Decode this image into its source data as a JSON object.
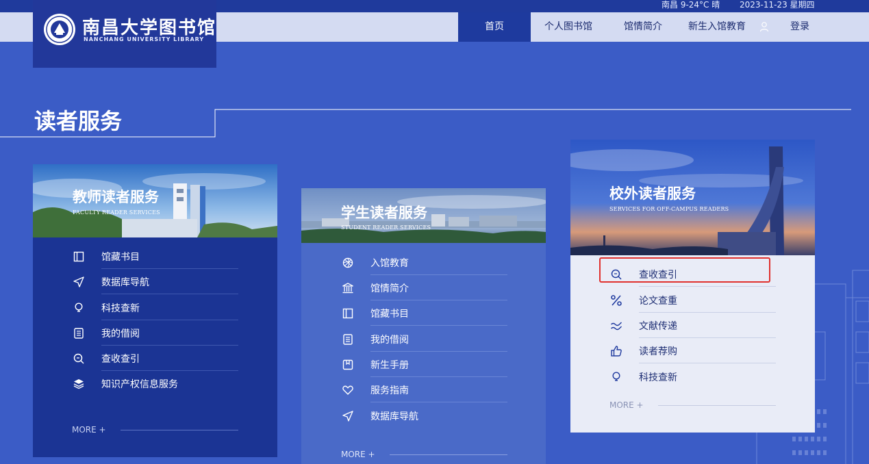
{
  "topbar": {
    "weather": "南昌 9-24°C 晴",
    "date": "2023-11-23 星期四"
  },
  "logo": {
    "name_cn": "南昌大学图书馆",
    "name_en": "NANCHANG UNIVERSITY  LIBRARY"
  },
  "nav": {
    "home": "首页",
    "personal": "个人图书馆",
    "intro": "馆情简介",
    "edu": "新生入馆教育",
    "login": "登录"
  },
  "section": {
    "title": "读者服务"
  },
  "teacher": {
    "title": "教师读者服务",
    "subtitle": "FACULTY READER SERVICES",
    "items": [
      {
        "label": "馆藏书目",
        "icon": "book-icon"
      },
      {
        "label": "数据库导航",
        "icon": "navigation-icon"
      },
      {
        "label": "科技查新",
        "icon": "lightbulb-icon"
      },
      {
        "label": "我的借阅",
        "icon": "document-icon"
      },
      {
        "label": "查收查引",
        "icon": "search-icon"
      },
      {
        "label": "知识产权信息服务",
        "icon": "layers-icon"
      }
    ],
    "more": "MORE +"
  },
  "student": {
    "title": "学生读者服务",
    "subtitle": "STUDENT READER SERVICES",
    "items": [
      {
        "label": "入馆教育",
        "icon": "flower-icon"
      },
      {
        "label": "馆情简介",
        "icon": "building-icon"
      },
      {
        "label": "馆藏书目",
        "icon": "book-icon"
      },
      {
        "label": "我的借阅",
        "icon": "document-icon"
      },
      {
        "label": "新生手册",
        "icon": "handbook-icon"
      },
      {
        "label": "服务指南",
        "icon": "heart-icon"
      },
      {
        "label": "数据库导航",
        "icon": "navigation-icon"
      }
    ],
    "more": "MORE +"
  },
  "outside": {
    "title": "校外读者服务",
    "subtitle": "SERVICES FOR OFF-CAMPUS READERS",
    "items": [
      {
        "label": "查收查引",
        "icon": "search-icon"
      },
      {
        "label": "论文查重",
        "icon": "percent-icon"
      },
      {
        "label": "文献传递",
        "icon": "transfer-icon"
      },
      {
        "label": "读者荐购",
        "icon": "thumbs-up-icon"
      },
      {
        "label": "科技查新",
        "icon": "lightbulb-icon"
      }
    ],
    "more": "MORE +"
  },
  "colors": {
    "page_bg": "#3b5cc6",
    "nav_bg": "#d4dbf2",
    "nav_active": "#1e3a9e",
    "teacher_card": "#1b3494",
    "student_card": "#4a6ac8",
    "outside_card": "#e9ecf7",
    "highlight": "#e0302d"
  }
}
